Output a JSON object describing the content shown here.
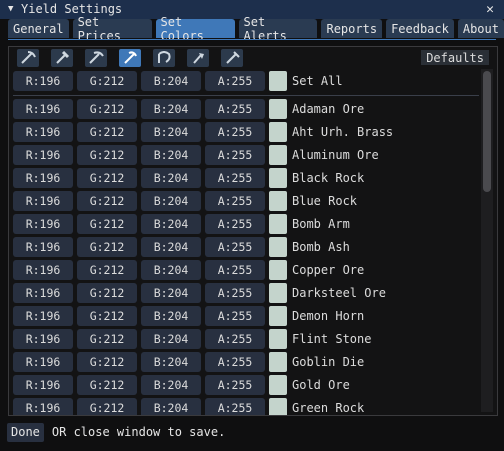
{
  "window": {
    "title": "Yield Settings",
    "close_symbol": "✕"
  },
  "tabs": [
    {
      "label": "General",
      "active": false
    },
    {
      "label": "Set Prices",
      "active": false
    },
    {
      "label": "Set Colors",
      "active": true
    },
    {
      "label": "Set Alerts",
      "active": false
    },
    {
      "label": "Reports",
      "active": false
    },
    {
      "label": "Feedback",
      "active": false
    },
    {
      "label": "About",
      "active": false
    }
  ],
  "tool_icons": [
    {
      "name": "pickaxe-icon-1",
      "selected": false
    },
    {
      "name": "pickaxe-icon-2",
      "selected": false
    },
    {
      "name": "pickaxe-icon-3",
      "selected": false
    },
    {
      "name": "pickaxe-icon-4",
      "selected": true
    },
    {
      "name": "sickle-icon",
      "selected": false
    },
    {
      "name": "axe-icon",
      "selected": false
    },
    {
      "name": "pick-icon",
      "selected": false
    }
  ],
  "defaults_label": "Defaults",
  "set_all": {
    "r": "R:196",
    "g": "G:212",
    "b": "B:204",
    "a": "A:255",
    "label": "Set All",
    "color": "#c4d4cc"
  },
  "rows": [
    {
      "r": "R:196",
      "g": "G:212",
      "b": "B:204",
      "a": "A:255",
      "label": "Adaman Ore"
    },
    {
      "r": "R:196",
      "g": "G:212",
      "b": "B:204",
      "a": "A:255",
      "label": "Aht Urh. Brass"
    },
    {
      "r": "R:196",
      "g": "G:212",
      "b": "B:204",
      "a": "A:255",
      "label": "Aluminum Ore"
    },
    {
      "r": "R:196",
      "g": "G:212",
      "b": "B:204",
      "a": "A:255",
      "label": "Black Rock"
    },
    {
      "r": "R:196",
      "g": "G:212",
      "b": "B:204",
      "a": "A:255",
      "label": "Blue Rock"
    },
    {
      "r": "R:196",
      "g": "G:212",
      "b": "B:204",
      "a": "A:255",
      "label": "Bomb Arm"
    },
    {
      "r": "R:196",
      "g": "G:212",
      "b": "B:204",
      "a": "A:255",
      "label": "Bomb Ash"
    },
    {
      "r": "R:196",
      "g": "G:212",
      "b": "B:204",
      "a": "A:255",
      "label": "Copper Ore"
    },
    {
      "r": "R:196",
      "g": "G:212",
      "b": "B:204",
      "a": "A:255",
      "label": "Darksteel Ore"
    },
    {
      "r": "R:196",
      "g": "G:212",
      "b": "B:204",
      "a": "A:255",
      "label": "Demon Horn"
    },
    {
      "r": "R:196",
      "g": "G:212",
      "b": "B:204",
      "a": "A:255",
      "label": "Flint Stone"
    },
    {
      "r": "R:196",
      "g": "G:212",
      "b": "B:204",
      "a": "A:255",
      "label": "Goblin Die"
    },
    {
      "r": "R:196",
      "g": "G:212",
      "b": "B:204",
      "a": "A:255",
      "label": "Gold Ore"
    },
    {
      "r": "R:196",
      "g": "G:212",
      "b": "B:204",
      "a": "A:255",
      "label": "Green Rock"
    }
  ],
  "footer": {
    "done_label": "Done",
    "text": "OR close window to save."
  },
  "colors": {
    "accent": "#3f78b8",
    "title_bar": "#1d2f4c",
    "swatch": "#c4d4cc"
  }
}
